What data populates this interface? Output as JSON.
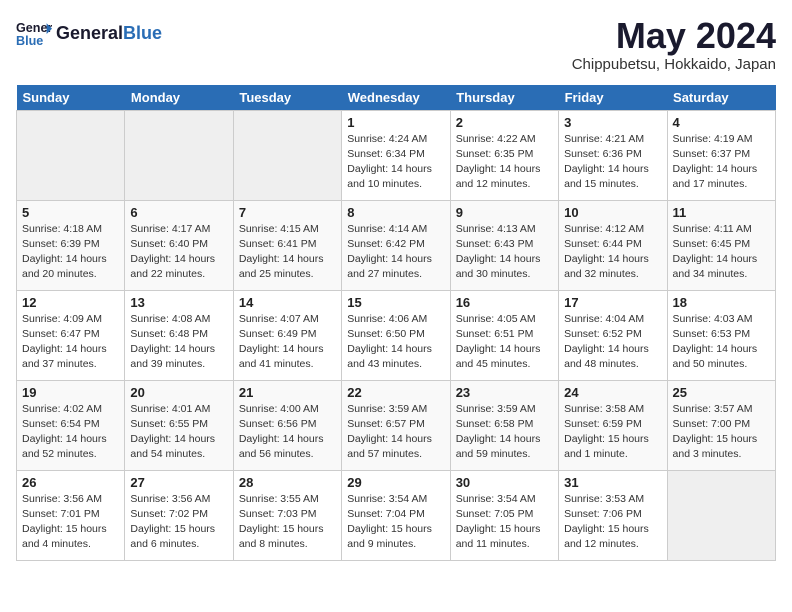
{
  "header": {
    "logo_line1": "General",
    "logo_line2": "Blue",
    "month": "May 2024",
    "location": "Chippubetsu, Hokkaido, Japan"
  },
  "weekdays": [
    "Sunday",
    "Monday",
    "Tuesday",
    "Wednesday",
    "Thursday",
    "Friday",
    "Saturday"
  ],
  "weeks": [
    [
      {
        "day": "",
        "info": ""
      },
      {
        "day": "",
        "info": ""
      },
      {
        "day": "",
        "info": ""
      },
      {
        "day": "1",
        "info": "Sunrise: 4:24 AM\nSunset: 6:34 PM\nDaylight: 14 hours\nand 10 minutes."
      },
      {
        "day": "2",
        "info": "Sunrise: 4:22 AM\nSunset: 6:35 PM\nDaylight: 14 hours\nand 12 minutes."
      },
      {
        "day": "3",
        "info": "Sunrise: 4:21 AM\nSunset: 6:36 PM\nDaylight: 14 hours\nand 15 minutes."
      },
      {
        "day": "4",
        "info": "Sunrise: 4:19 AM\nSunset: 6:37 PM\nDaylight: 14 hours\nand 17 minutes."
      }
    ],
    [
      {
        "day": "5",
        "info": "Sunrise: 4:18 AM\nSunset: 6:39 PM\nDaylight: 14 hours\nand 20 minutes."
      },
      {
        "day": "6",
        "info": "Sunrise: 4:17 AM\nSunset: 6:40 PM\nDaylight: 14 hours\nand 22 minutes."
      },
      {
        "day": "7",
        "info": "Sunrise: 4:15 AM\nSunset: 6:41 PM\nDaylight: 14 hours\nand 25 minutes."
      },
      {
        "day": "8",
        "info": "Sunrise: 4:14 AM\nSunset: 6:42 PM\nDaylight: 14 hours\nand 27 minutes."
      },
      {
        "day": "9",
        "info": "Sunrise: 4:13 AM\nSunset: 6:43 PM\nDaylight: 14 hours\nand 30 minutes."
      },
      {
        "day": "10",
        "info": "Sunrise: 4:12 AM\nSunset: 6:44 PM\nDaylight: 14 hours\nand 32 minutes."
      },
      {
        "day": "11",
        "info": "Sunrise: 4:11 AM\nSunset: 6:45 PM\nDaylight: 14 hours\nand 34 minutes."
      }
    ],
    [
      {
        "day": "12",
        "info": "Sunrise: 4:09 AM\nSunset: 6:47 PM\nDaylight: 14 hours\nand 37 minutes."
      },
      {
        "day": "13",
        "info": "Sunrise: 4:08 AM\nSunset: 6:48 PM\nDaylight: 14 hours\nand 39 minutes."
      },
      {
        "day": "14",
        "info": "Sunrise: 4:07 AM\nSunset: 6:49 PM\nDaylight: 14 hours\nand 41 minutes."
      },
      {
        "day": "15",
        "info": "Sunrise: 4:06 AM\nSunset: 6:50 PM\nDaylight: 14 hours\nand 43 minutes."
      },
      {
        "day": "16",
        "info": "Sunrise: 4:05 AM\nSunset: 6:51 PM\nDaylight: 14 hours\nand 45 minutes."
      },
      {
        "day": "17",
        "info": "Sunrise: 4:04 AM\nSunset: 6:52 PM\nDaylight: 14 hours\nand 48 minutes."
      },
      {
        "day": "18",
        "info": "Sunrise: 4:03 AM\nSunset: 6:53 PM\nDaylight: 14 hours\nand 50 minutes."
      }
    ],
    [
      {
        "day": "19",
        "info": "Sunrise: 4:02 AM\nSunset: 6:54 PM\nDaylight: 14 hours\nand 52 minutes."
      },
      {
        "day": "20",
        "info": "Sunrise: 4:01 AM\nSunset: 6:55 PM\nDaylight: 14 hours\nand 54 minutes."
      },
      {
        "day": "21",
        "info": "Sunrise: 4:00 AM\nSunset: 6:56 PM\nDaylight: 14 hours\nand 56 minutes."
      },
      {
        "day": "22",
        "info": "Sunrise: 3:59 AM\nSunset: 6:57 PM\nDaylight: 14 hours\nand 57 minutes."
      },
      {
        "day": "23",
        "info": "Sunrise: 3:59 AM\nSunset: 6:58 PM\nDaylight: 14 hours\nand 59 minutes."
      },
      {
        "day": "24",
        "info": "Sunrise: 3:58 AM\nSunset: 6:59 PM\nDaylight: 15 hours\nand 1 minute."
      },
      {
        "day": "25",
        "info": "Sunrise: 3:57 AM\nSunset: 7:00 PM\nDaylight: 15 hours\nand 3 minutes."
      }
    ],
    [
      {
        "day": "26",
        "info": "Sunrise: 3:56 AM\nSunset: 7:01 PM\nDaylight: 15 hours\nand 4 minutes."
      },
      {
        "day": "27",
        "info": "Sunrise: 3:56 AM\nSunset: 7:02 PM\nDaylight: 15 hours\nand 6 minutes."
      },
      {
        "day": "28",
        "info": "Sunrise: 3:55 AM\nSunset: 7:03 PM\nDaylight: 15 hours\nand 8 minutes."
      },
      {
        "day": "29",
        "info": "Sunrise: 3:54 AM\nSunset: 7:04 PM\nDaylight: 15 hours\nand 9 minutes."
      },
      {
        "day": "30",
        "info": "Sunrise: 3:54 AM\nSunset: 7:05 PM\nDaylight: 15 hours\nand 11 minutes."
      },
      {
        "day": "31",
        "info": "Sunrise: 3:53 AM\nSunset: 7:06 PM\nDaylight: 15 hours\nand 12 minutes."
      },
      {
        "day": "",
        "info": ""
      }
    ]
  ]
}
